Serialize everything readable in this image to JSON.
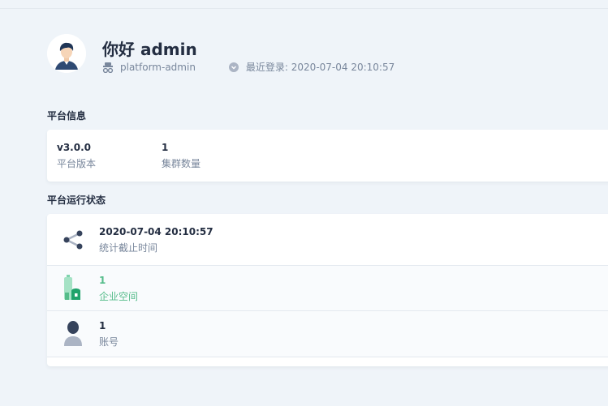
{
  "header": {
    "greeting": "你好 admin",
    "role": "platform-admin",
    "last_login": "最近登录: 2020-07-04 20:10:57"
  },
  "platform_info": {
    "title": "平台信息",
    "version_value": "v3.0.0",
    "version_label": "平台版本",
    "cluster_value": "1",
    "cluster_label": "集群数量"
  },
  "platform_status": {
    "title": "平台运行状态",
    "rows": [
      {
        "value": "2020-07-04 20:10:57",
        "label": "统计截止时间",
        "icon": "share-nodes-icon"
      },
      {
        "value": "1",
        "label": "企业空间",
        "icon": "workspace-icon"
      },
      {
        "value": "1",
        "label": "账号",
        "icon": "user-icon"
      }
    ]
  },
  "colors": {
    "accent_green": "#55bc8a",
    "text_dark": "#242e42",
    "text_muted": "#79879c",
    "background": "#eff4f9"
  }
}
